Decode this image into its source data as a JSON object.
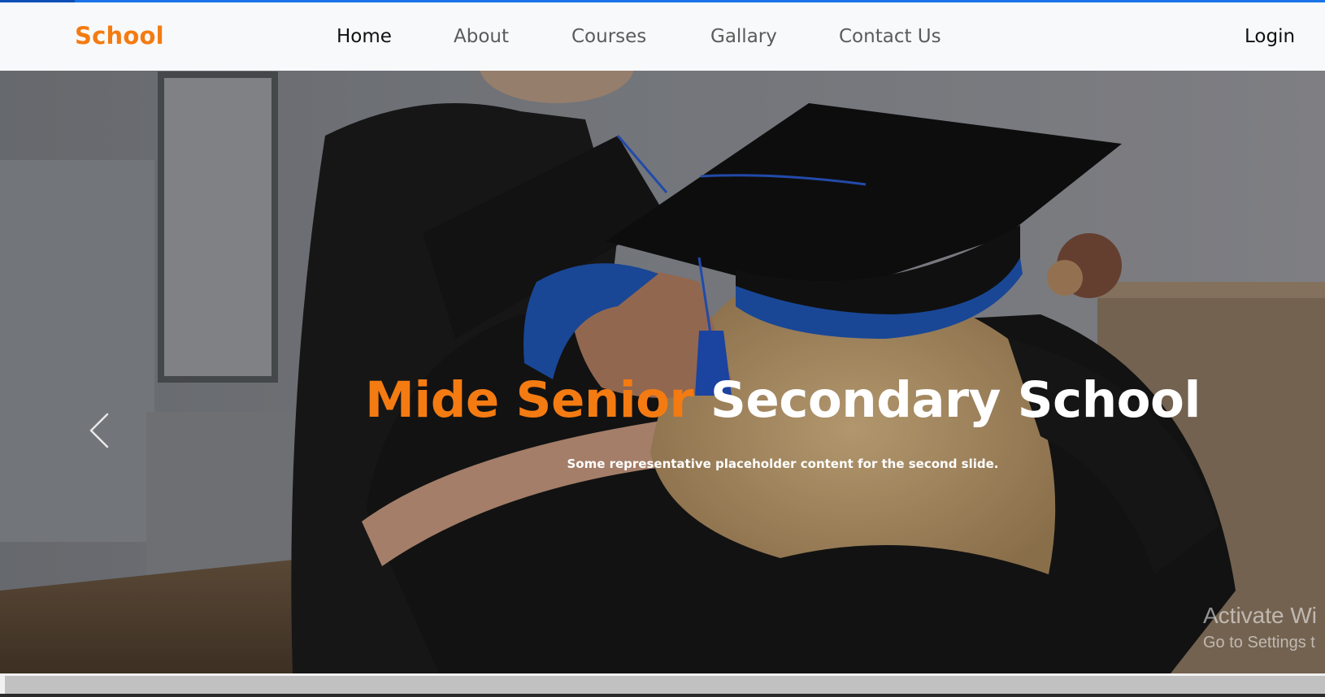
{
  "brand": "School",
  "nav": {
    "links": [
      {
        "label": "Home",
        "active": true
      },
      {
        "label": "About",
        "active": false
      },
      {
        "label": "Courses",
        "active": false
      },
      {
        "label": "Gallary",
        "active": false
      },
      {
        "label": "Contact Us",
        "active": false
      }
    ],
    "login": "Login"
  },
  "hero": {
    "title_accent": "Mide Senior",
    "title_rest": "Secondary School",
    "subtitle": "Some representative placeholder content for the second slide.",
    "prev_icon": "chevron-left-icon",
    "image": "graduates-hugging-photo"
  },
  "watermark": {
    "line1": "Activate Wi",
    "line2": "Go to Settings t"
  },
  "colors": {
    "accent": "#f47b12",
    "navbar_bg": "#f8f9fa",
    "top_line": "#1a73e8",
    "gown_blue": "#1f57b8"
  }
}
